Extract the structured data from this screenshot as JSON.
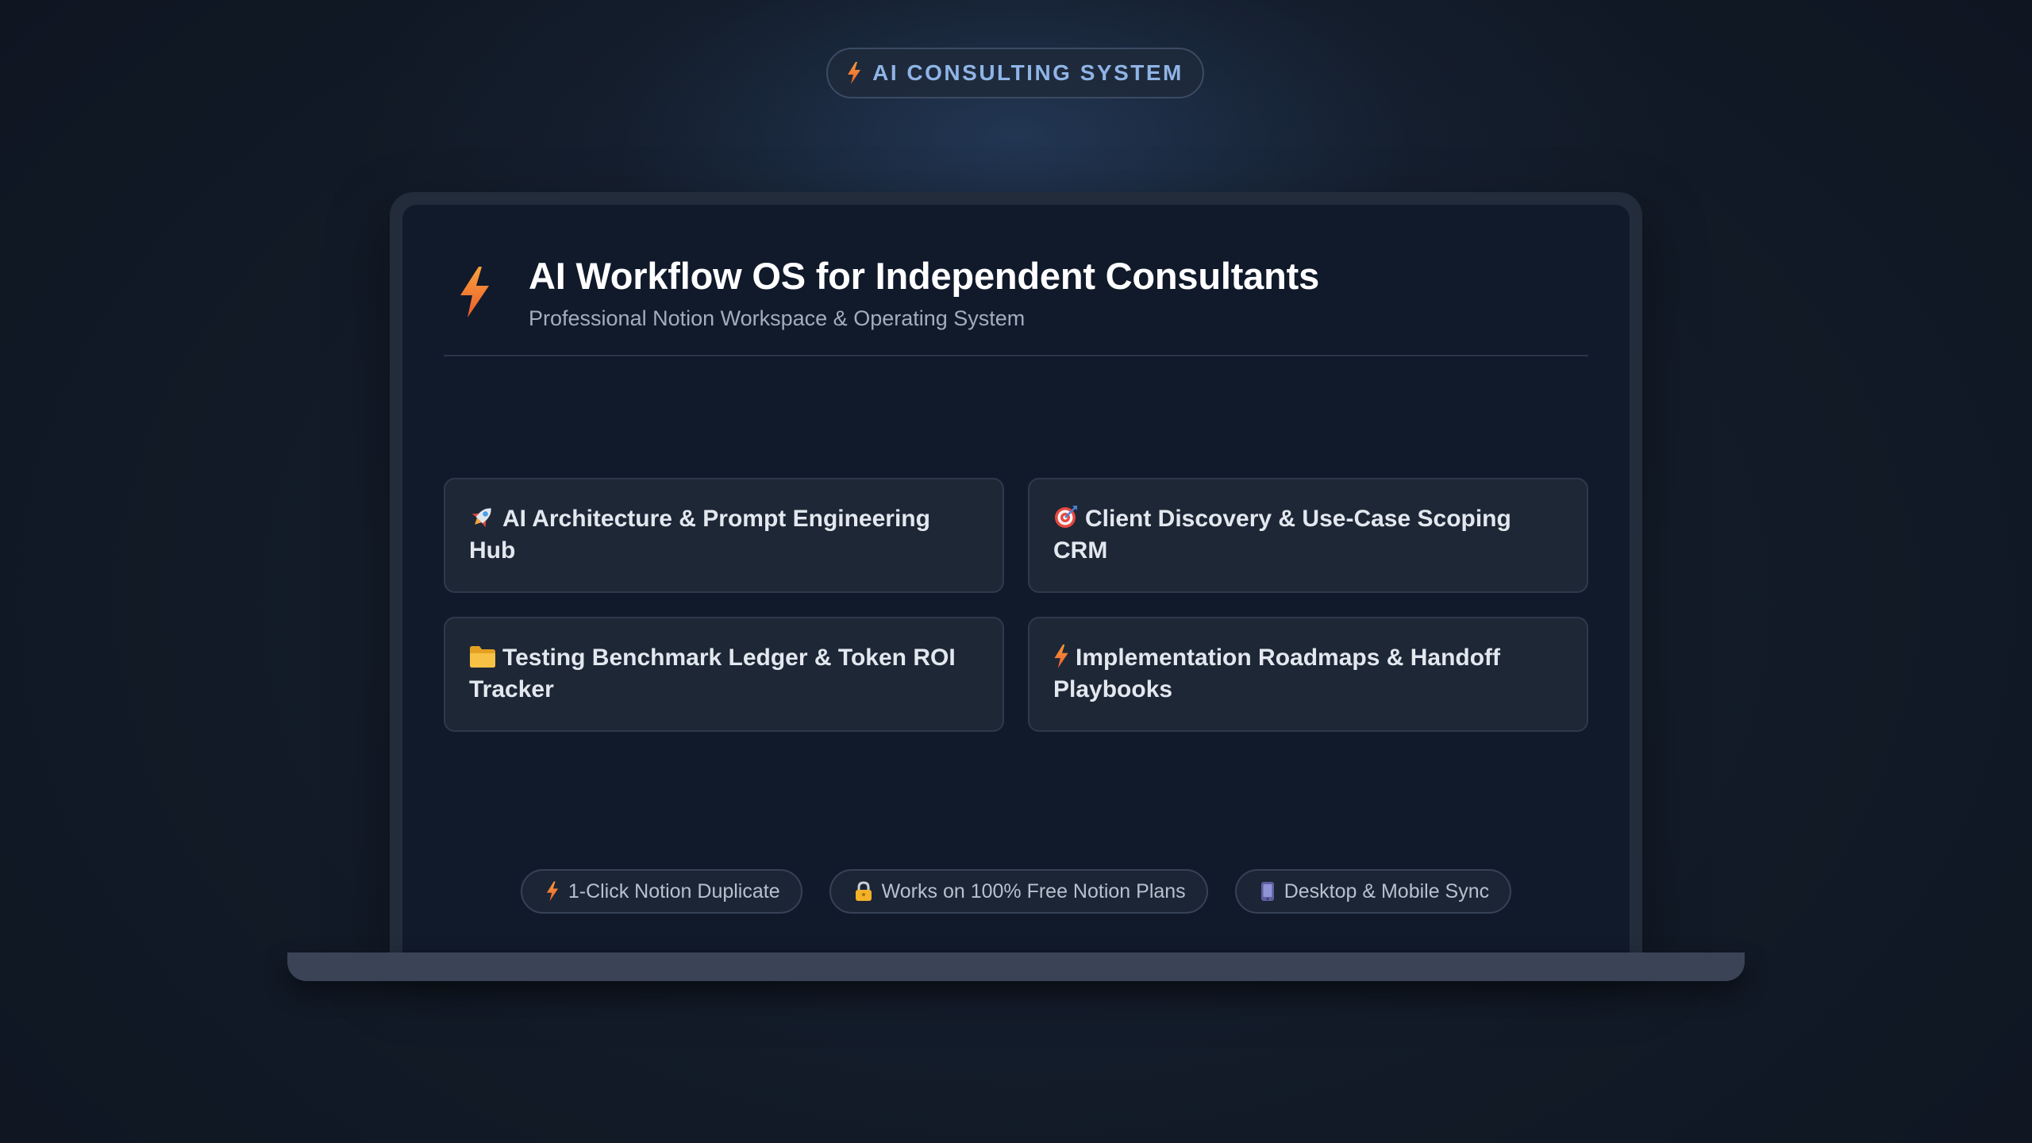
{
  "badge": {
    "icon": "lightning-bolt-icon",
    "label": "AI CONSULTING SYSTEM"
  },
  "header": {
    "icon": "lightning-bolt-icon",
    "title": "AI Workflow OS for Independent Consultants",
    "subtitle": "Professional Notion Workspace & Operating System"
  },
  "cards": [
    {
      "icon": "rocket-icon",
      "label": "AI Architecture & Prompt Engineering Hub"
    },
    {
      "icon": "target-icon",
      "label": "Client Discovery & Use-Case Scoping CRM"
    },
    {
      "icon": "folder-icon",
      "label": "Testing Benchmark Ledger & Token ROI Tracker"
    },
    {
      "icon": "lightning-bolt-icon",
      "label": "Implementation Roadmaps & Handoff Playbooks"
    }
  ],
  "features": [
    {
      "icon": "lightning-bolt-icon",
      "label": "1-Click Notion Duplicate"
    },
    {
      "icon": "lock-icon",
      "label": "Works on 100% Free Notion Plans"
    },
    {
      "icon": "mobile-phone-icon",
      "label": "Desktop & Mobile Sync"
    }
  ],
  "colors": {
    "background": "#131b28",
    "screen": "#111a2b",
    "card": "#1e2736",
    "accent_orange": "#f5813a",
    "badge_text": "#8fb4e6"
  }
}
